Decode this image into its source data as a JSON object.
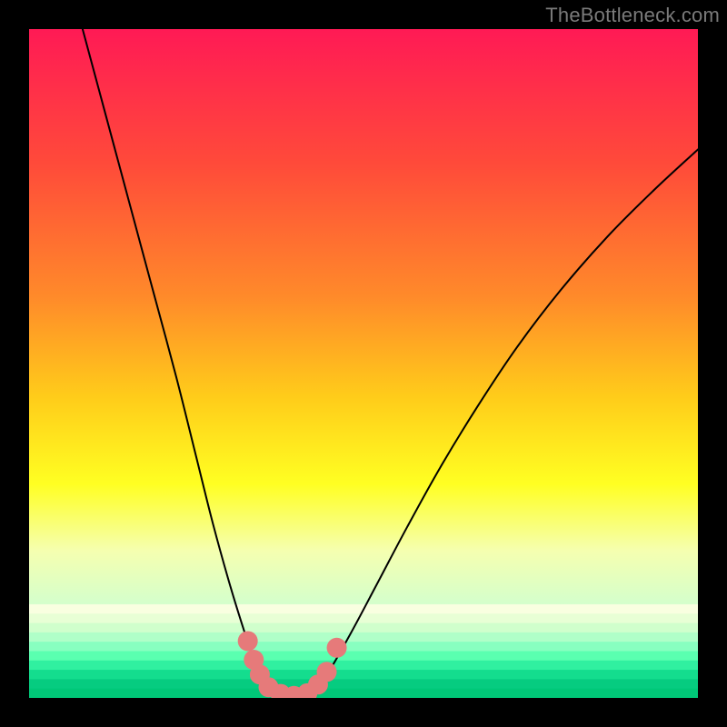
{
  "watermark": "TheBottleneck.com",
  "chart_data": {
    "type": "line",
    "title": "",
    "xlabel": "",
    "ylabel": "",
    "xlim": [
      0,
      1
    ],
    "ylim": [
      0,
      1
    ],
    "background": {
      "type": "vertical-gradient",
      "stops": [
        {
          "offset": 0.0,
          "color": "#ff1a55"
        },
        {
          "offset": 0.2,
          "color": "#ff4a3a"
        },
        {
          "offset": 0.4,
          "color": "#ff8a2a"
        },
        {
          "offset": 0.55,
          "color": "#ffcc1a"
        },
        {
          "offset": 0.68,
          "color": "#ffff22"
        },
        {
          "offset": 0.78,
          "color": "#f5ffb0"
        },
        {
          "offset": 0.86,
          "color": "#d4ffcc"
        },
        {
          "offset": 0.93,
          "color": "#7cffb4"
        },
        {
          "offset": 0.97,
          "color": "#22e88a"
        },
        {
          "offset": 1.0,
          "color": "#00c878"
        }
      ]
    },
    "series": [
      {
        "name": "bottleneck-curve",
        "color": "#000000",
        "stroke_width": 2,
        "points": [
          {
            "x": 0.08,
            "y": 1.0
          },
          {
            "x": 0.115,
            "y": 0.87
          },
          {
            "x": 0.15,
            "y": 0.74
          },
          {
            "x": 0.185,
            "y": 0.61
          },
          {
            "x": 0.22,
            "y": 0.48
          },
          {
            "x": 0.25,
            "y": 0.36
          },
          {
            "x": 0.275,
            "y": 0.26
          },
          {
            "x": 0.3,
            "y": 0.17
          },
          {
            "x": 0.32,
            "y": 0.105
          },
          {
            "x": 0.335,
            "y": 0.06
          },
          {
            "x": 0.35,
            "y": 0.03
          },
          {
            "x": 0.37,
            "y": 0.01
          },
          {
            "x": 0.395,
            "y": 0.003
          },
          {
            "x": 0.42,
            "y": 0.01
          },
          {
            "x": 0.445,
            "y": 0.035
          },
          {
            "x": 0.48,
            "y": 0.095
          },
          {
            "x": 0.52,
            "y": 0.17
          },
          {
            "x": 0.565,
            "y": 0.255
          },
          {
            "x": 0.615,
            "y": 0.345
          },
          {
            "x": 0.67,
            "y": 0.435
          },
          {
            "x": 0.73,
            "y": 0.525
          },
          {
            "x": 0.795,
            "y": 0.61
          },
          {
            "x": 0.865,
            "y": 0.69
          },
          {
            "x": 0.935,
            "y": 0.76
          },
          {
            "x": 1.0,
            "y": 0.82
          }
        ]
      }
    ],
    "markers": {
      "name": "optimal-zone-markers",
      "color": "#e67a7a",
      "radius": 11,
      "points": [
        {
          "x": 0.327,
          "y": 0.085
        },
        {
          "x": 0.336,
          "y": 0.057
        },
        {
          "x": 0.345,
          "y": 0.035
        },
        {
          "x": 0.358,
          "y": 0.016
        },
        {
          "x": 0.376,
          "y": 0.006
        },
        {
          "x": 0.396,
          "y": 0.003
        },
        {
          "x": 0.416,
          "y": 0.007
        },
        {
          "x": 0.432,
          "y": 0.02
        },
        {
          "x": 0.445,
          "y": 0.039
        },
        {
          "x": 0.46,
          "y": 0.075
        }
      ]
    }
  }
}
